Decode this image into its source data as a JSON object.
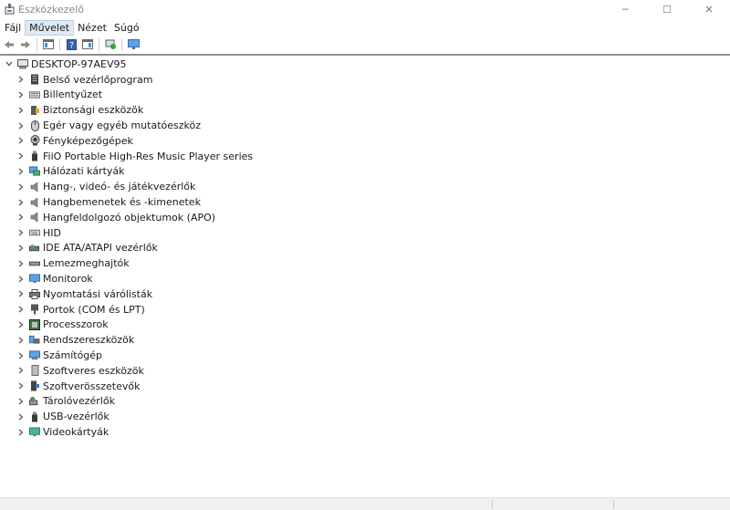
{
  "window": {
    "title": "Eszközkezelő",
    "minimize": "─",
    "maximize": "☐",
    "close": "✕"
  },
  "menu": [
    {
      "label": "Fájl"
    },
    {
      "label": "Művelet"
    },
    {
      "label": "Nézet"
    },
    {
      "label": "Súgó"
    }
  ],
  "tree": {
    "root": "DESKTOP-97AEV95",
    "items": [
      {
        "label": "Belső vezérlőprogram",
        "icon": "firmware-icon"
      },
      {
        "label": "Billentyűzet",
        "icon": "keyboard-icon"
      },
      {
        "label": "Biztonsági eszközök",
        "icon": "security-device-icon"
      },
      {
        "label": "Egér vagy egyéb mutatóeszköz",
        "icon": "mouse-icon"
      },
      {
        "label": "Fényképezőgépek",
        "icon": "camera-icon"
      },
      {
        "label": "FiiO Portable High-Res Music Player series",
        "icon": "usb-device-icon"
      },
      {
        "label": "Hálózati kártyák",
        "icon": "network-adapter-icon"
      },
      {
        "label": "Hang-, videó- és játékvezérlők",
        "icon": "speaker-icon"
      },
      {
        "label": "Hangbemenetek és -kimenetek",
        "icon": "speaker-icon"
      },
      {
        "label": "Hangfeldolgozó objektumok (APO)",
        "icon": "speaker-icon"
      },
      {
        "label": "HID",
        "icon": "hid-icon"
      },
      {
        "label": "IDE ATA/ATAPI vezérlők",
        "icon": "ide-controller-icon"
      },
      {
        "label": "Lemezmeghajtók",
        "icon": "disk-drive-icon"
      },
      {
        "label": "Monitorok",
        "icon": "monitor-icon"
      },
      {
        "label": "Nyomtatási várólisták",
        "icon": "printer-icon"
      },
      {
        "label": "Portok (COM és LPT)",
        "icon": "port-icon"
      },
      {
        "label": "Processzorok",
        "icon": "processor-icon"
      },
      {
        "label": "Rendszereszközök",
        "icon": "system-devices-icon"
      },
      {
        "label": "Számítógép",
        "icon": "computer-icon"
      },
      {
        "label": "Szoftveres eszközök",
        "icon": "software-device-icon"
      },
      {
        "label": "Szoftverösszetevők",
        "icon": "software-component-icon"
      },
      {
        "label": "Tárolóvezérlők",
        "icon": "storage-controller-icon"
      },
      {
        "label": "USB-vezérlők",
        "icon": "usb-icon"
      },
      {
        "label": "Videokártyák",
        "icon": "display-adapter-icon"
      }
    ]
  },
  "colors": {
    "accent": "#2f78c9",
    "menu_active_bg": "#dfe9f6",
    "divider": "#8e8e8e"
  }
}
